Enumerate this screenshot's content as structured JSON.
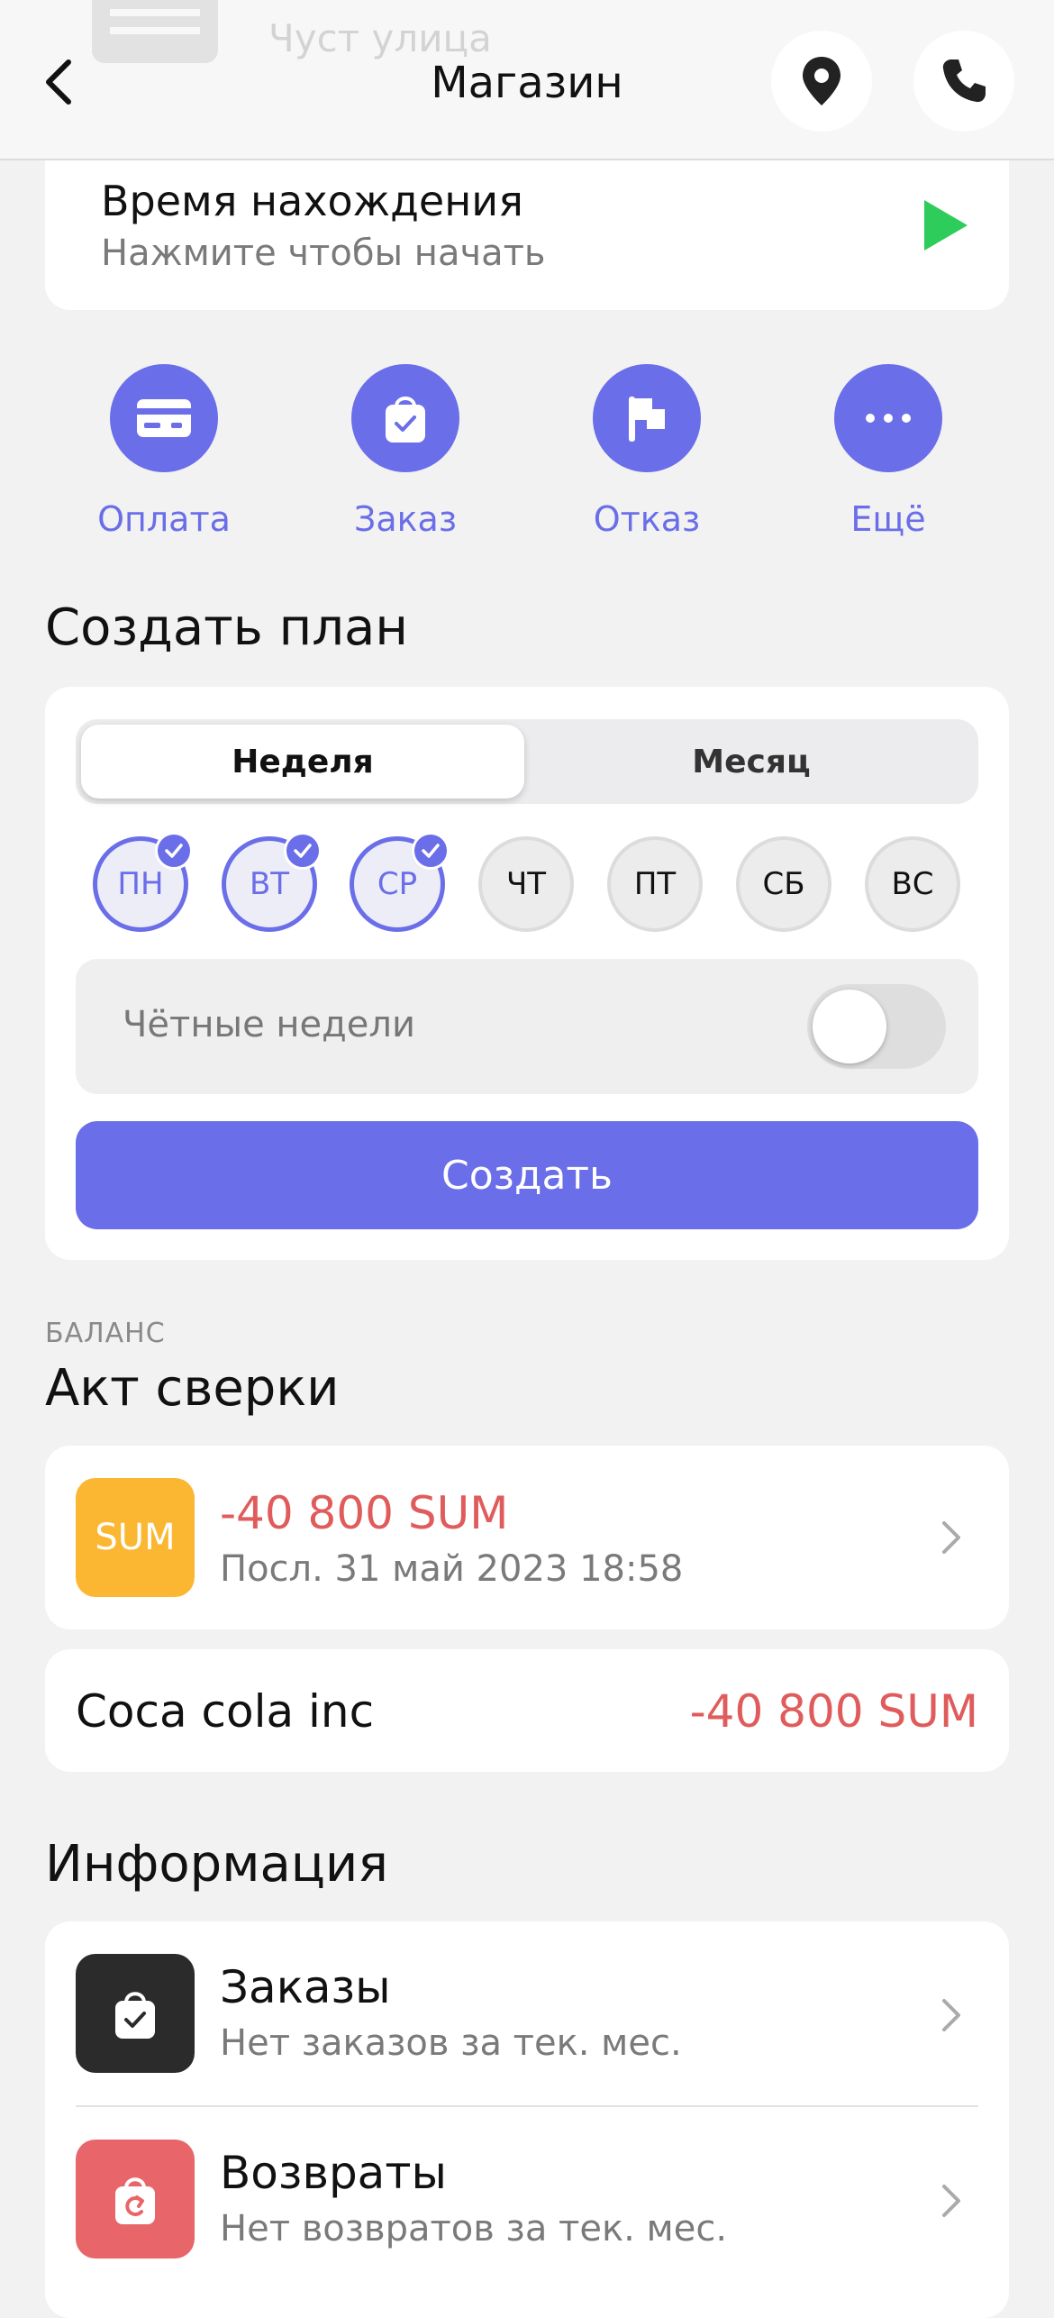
{
  "header": {
    "title": "Магазин",
    "ghost_text": "Чуст улица"
  },
  "timer": {
    "title": "Время нахождения",
    "subtitle": "Нажмите чтобы начать"
  },
  "actions": [
    {
      "label": "Оплата",
      "icon": "card-icon"
    },
    {
      "label": "Заказ",
      "icon": "bag-check-icon"
    },
    {
      "label": "Отказ",
      "icon": "flag-icon"
    },
    {
      "label": "Ещё",
      "icon": "more-icon"
    }
  ],
  "plan": {
    "title": "Создать план",
    "tabs": [
      "Неделя",
      "Месяц"
    ],
    "active_tab": "Неделя",
    "days": [
      {
        "label": "ПН",
        "selected": true
      },
      {
        "label": "ВТ",
        "selected": true
      },
      {
        "label": "СР",
        "selected": true
      },
      {
        "label": "ЧТ",
        "selected": false
      },
      {
        "label": "ПТ",
        "selected": false
      },
      {
        "label": "СБ",
        "selected": false
      },
      {
        "label": "ВС",
        "selected": false
      }
    ],
    "even_weeks_label": "Чётные недели",
    "even_weeks_on": false,
    "create_label": "Создать"
  },
  "balance": {
    "overline": "БАЛАНС",
    "title": "Акт сверки",
    "badge": "SUM",
    "amount": "-40 800 SUM",
    "last_update": "Посл. 31 май 2023 18:58",
    "company_name": "Coca cola inc",
    "company_amount": "-40 800 SUM"
  },
  "info": {
    "title": "Информация",
    "items": [
      {
        "title": "Заказы",
        "subtitle": "Нет заказов за тек. мес."
      },
      {
        "title": "Возвраты",
        "subtitle": "Нет возвратов за тек. мес."
      }
    ]
  },
  "colors": {
    "accent": "#6a6ee8",
    "negative": "#e05c5c",
    "play": "#2ecc5a",
    "sum_badge": "#fbb731",
    "orders_icon_bg": "#2b2b2b",
    "returns_icon_bg": "#e8666a",
    "background": "#f2f2f2"
  }
}
